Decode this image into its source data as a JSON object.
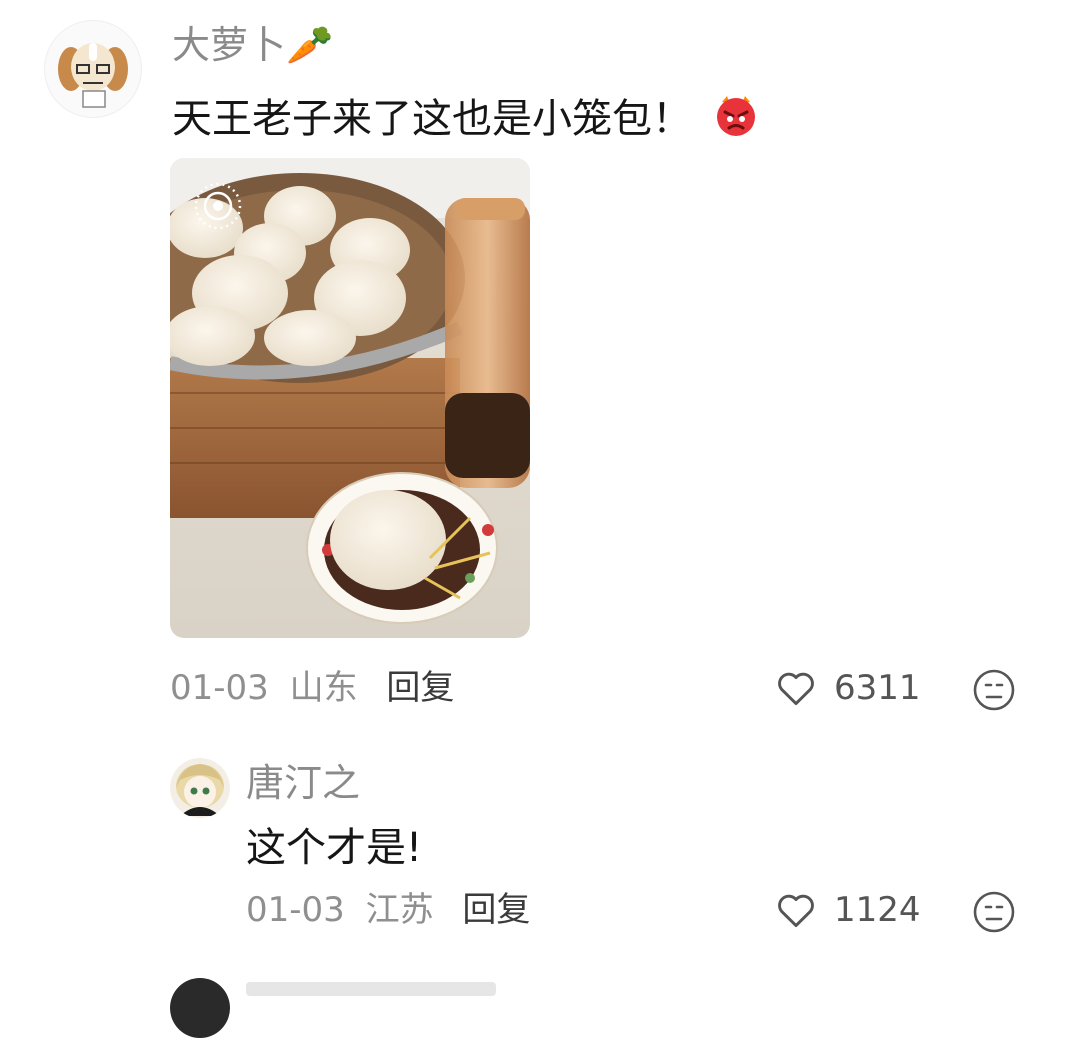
{
  "comments": [
    {
      "username": "大萝卜🥕",
      "text": "天王老子来了这也是小笼包！",
      "emoji": "😡",
      "date": "01-03",
      "location": "山东",
      "reply_label": "回复",
      "likes": "6311",
      "has_photo": true
    },
    {
      "username": "唐汀之",
      "text": "这个才是!",
      "date": "01-03",
      "location": "江苏",
      "reply_label": "回复",
      "likes": "1124"
    }
  ],
  "colors": {
    "username": "#8a8a8a",
    "text": "#161616",
    "meta": "#8f8f8f",
    "icon": "#555555"
  },
  "icons": [
    "heart-outline-icon",
    "meh-face-icon",
    "live-photo-icon"
  ]
}
